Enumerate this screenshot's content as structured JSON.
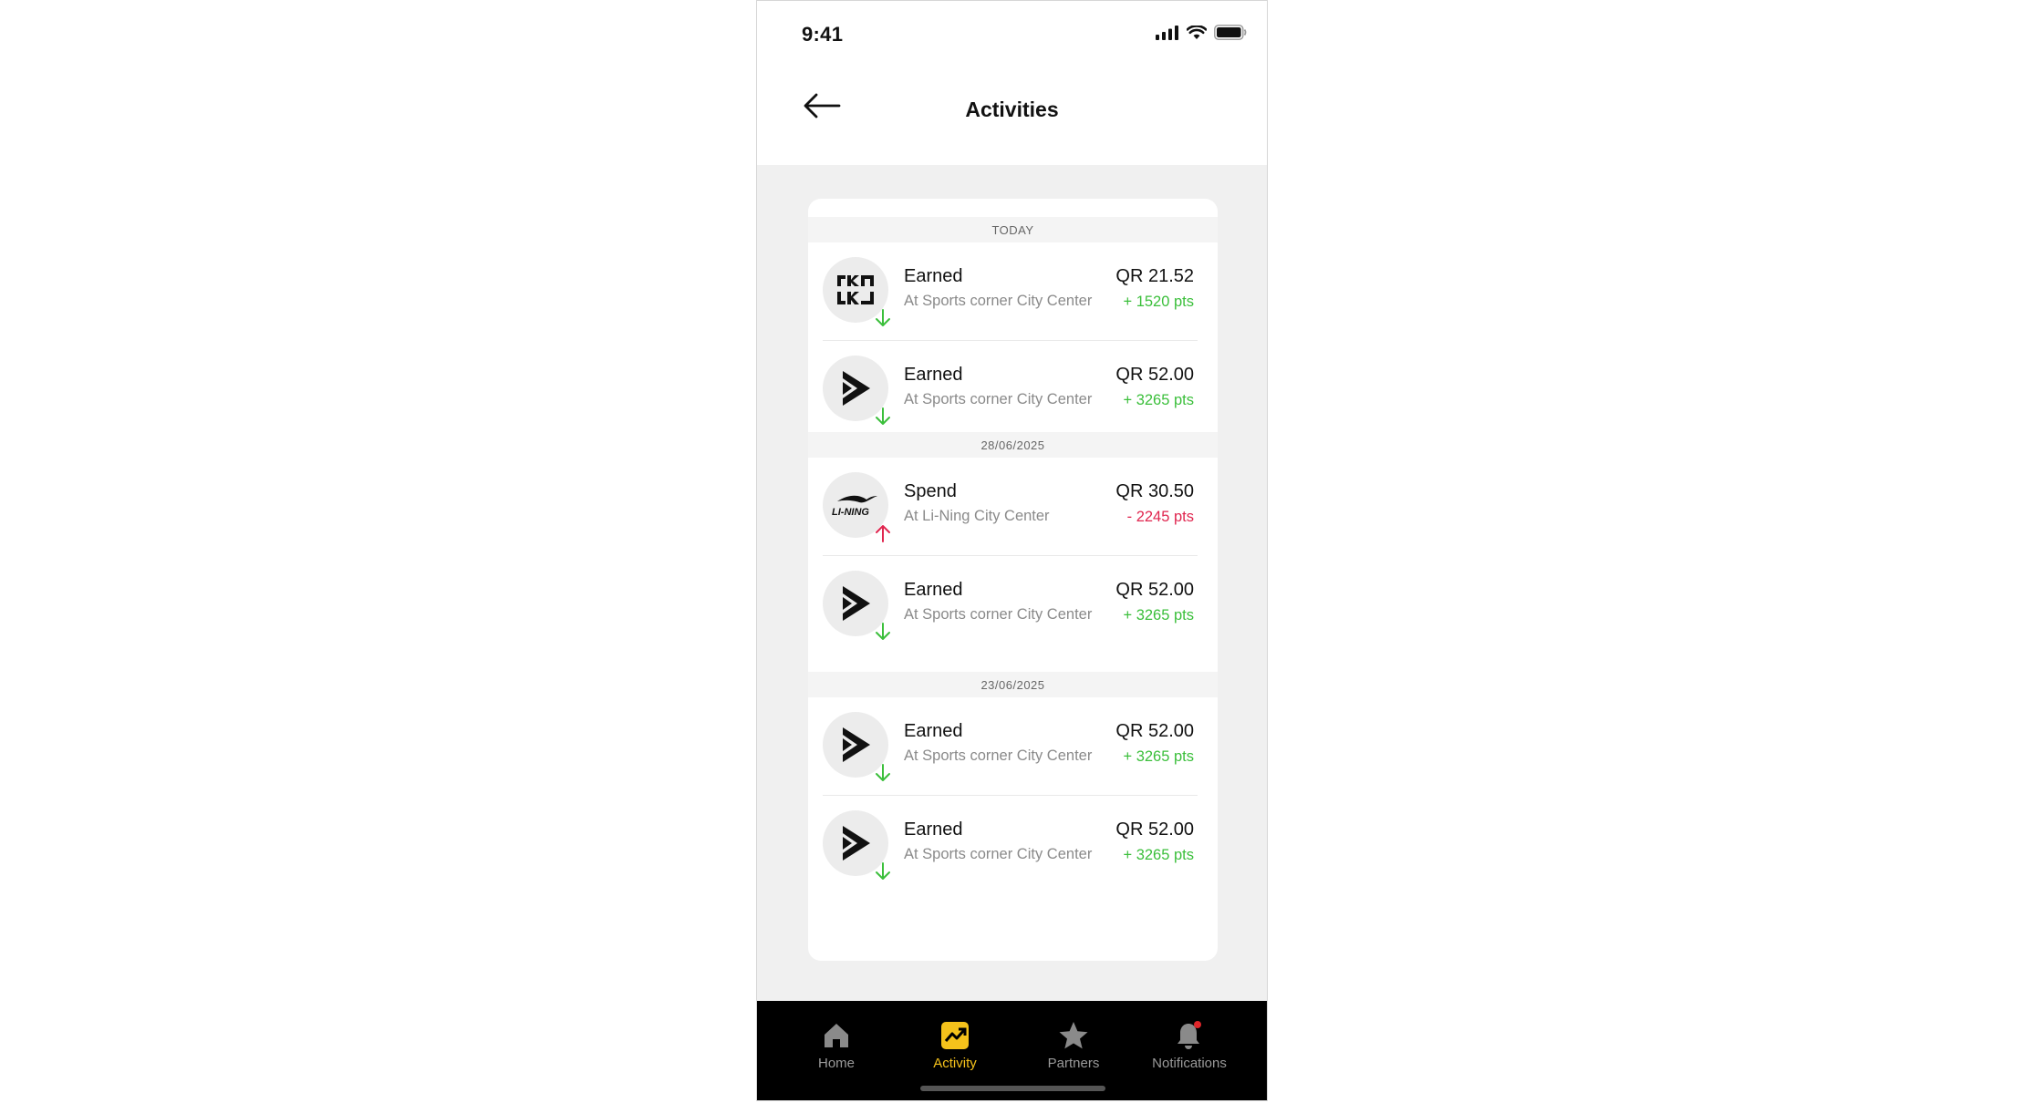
{
  "status_bar": {
    "time": "9:41"
  },
  "header": {
    "title": "Activities"
  },
  "sections": [
    {
      "label": "TODAY"
    },
    {
      "label": "28/06/2025"
    },
    {
      "label": "23/06/2025"
    }
  ],
  "activities": [
    {
      "type": "Earned",
      "location": "At Sports corner City Center",
      "amount": "QR 21.52",
      "points": "+ 1520 pts",
      "direction": "earned",
      "logo": "ckn-logo-icon"
    },
    {
      "type": "Earned",
      "location": "At Sports corner City Center",
      "amount": "QR 52.00",
      "points": "+ 3265 pts",
      "direction": "earned",
      "logo": "sports-corner-logo-icon"
    },
    {
      "type": "Spend",
      "location": "At Li-Ning City Center",
      "amount": "QR 30.50",
      "points": "- 2245 pts",
      "direction": "spent",
      "logo": "li-ning-logo-icon",
      "logo_text": "LI-NING"
    },
    {
      "type": "Earned",
      "location": "At Sports corner City Center",
      "amount": "QR 52.00",
      "points": "+ 3265 pts",
      "direction": "earned",
      "logo": "sports-corner-logo-icon"
    },
    {
      "type": "Earned",
      "location": "At Sports corner City Center",
      "amount": "QR 52.00",
      "points": "+ 3265 pts",
      "direction": "earned",
      "logo": "sports-corner-logo-icon"
    },
    {
      "type": "Earned",
      "location": "At Sports corner City Center",
      "amount": "QR 52.00",
      "points": "+ 3265 pts",
      "direction": "earned",
      "logo": "sports-corner-logo-icon"
    }
  ],
  "tabbar": {
    "items": [
      {
        "label": "Home",
        "icon": "home-icon"
      },
      {
        "label": "Activity",
        "icon": "activity-icon",
        "active": true
      },
      {
        "label": "Partners",
        "icon": "star-icon"
      },
      {
        "label": "Notifications",
        "icon": "bell-icon",
        "badge": true
      }
    ]
  },
  "colors": {
    "accent": "#f5c21b",
    "earned": "#3bbf3b",
    "spent": "#e0264f",
    "badge": "#e0262a"
  }
}
